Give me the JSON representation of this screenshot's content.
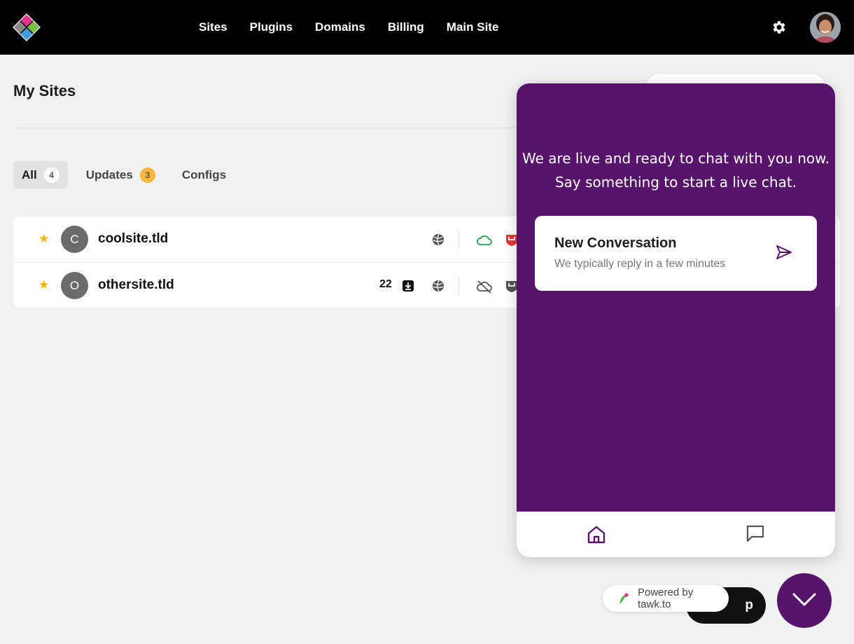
{
  "nav": {
    "items": [
      "Sites",
      "Plugins",
      "Domains",
      "Billing",
      "Main Site"
    ]
  },
  "page": {
    "title": "My Sites"
  },
  "tabs": [
    {
      "label": "All",
      "count": "4"
    },
    {
      "label": "Updates",
      "count": "3"
    },
    {
      "label": "Configs",
      "count": ""
    }
  ],
  "sites": [
    {
      "initial": "C",
      "name": "coolsite.tld",
      "updates": ""
    },
    {
      "initial": "O",
      "name": "othersite.tld",
      "updates": "22"
    }
  ],
  "chat": {
    "greeting_line1": "We are live and ready to chat with you now.",
    "greeting_line2": "Say something to start a live chat.",
    "card_title": "New Conversation",
    "card_subtitle": "We typically reply in a few minutes",
    "powered": "Powered by tawk.to",
    "help_label": "p"
  },
  "colors": {
    "chat_purple": "#58146a",
    "star": "#f4b400",
    "updates_badge": "#f6b73c",
    "cloud_ok": "#22a24a",
    "shield_alert": "#e53935"
  },
  "icons": [
    "logo-icon",
    "gear-icon",
    "star-icon",
    "globe-icon",
    "cloud-icon",
    "cloud-off-icon",
    "shield-icon",
    "download-icon",
    "send-icon",
    "home-icon",
    "message-icon",
    "chevron-down-icon"
  ]
}
